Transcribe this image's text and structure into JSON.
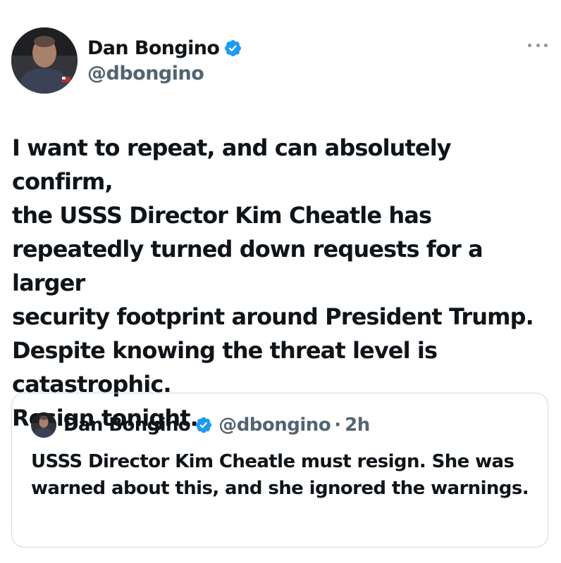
{
  "author": {
    "display_name": "Dan Bongino",
    "handle": "@dbongino",
    "verified": true,
    "avatar_icon": "avatar-photo"
  },
  "post": {
    "text": "I want to repeat, and can absolutely confirm,\nthe USSS Director Kim Cheatle has\nrepeatedly turned down requests for a larger\nsecurity footprint around President Trump.\nDespite knowing the threat level is\ncatastrophic.\nResign tonight."
  },
  "quoted_post": {
    "display_name": "Dan Bongino",
    "handle": "@dbongino",
    "separator": "·",
    "time": "2h",
    "verified": true,
    "text": "USSS Director Kim Cheatle must resign. She was warned about this, and she ignored the warnings."
  },
  "icons": {
    "verified": "verified-badge-icon",
    "more": "more-options-icon"
  },
  "colors": {
    "text": "#0f1419",
    "secondary": "#536471",
    "verified_blue": "#1d9bf0",
    "border": "#cfd9de"
  }
}
